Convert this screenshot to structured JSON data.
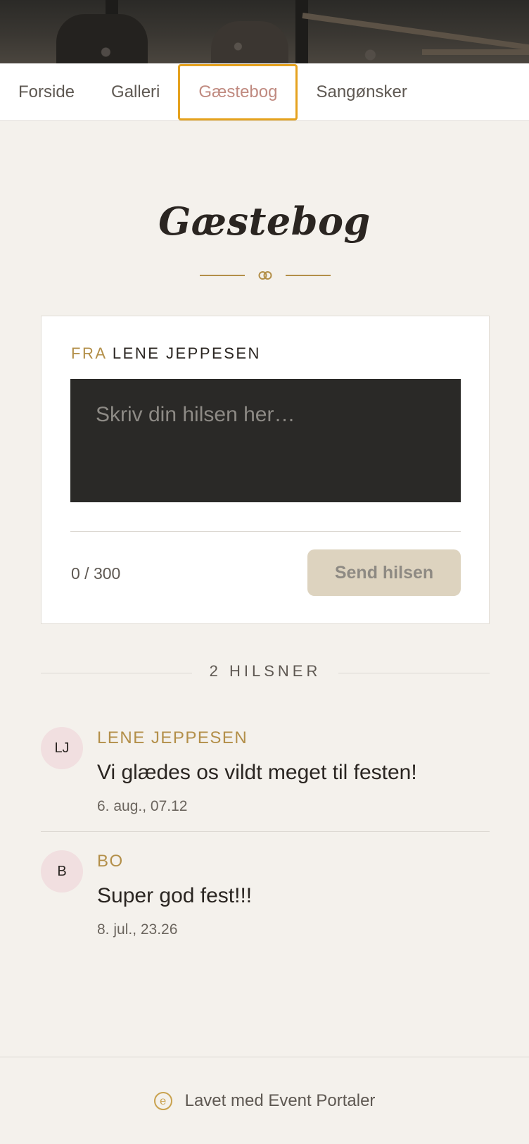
{
  "nav": {
    "items": [
      {
        "label": "Forside"
      },
      {
        "label": "Galleri"
      },
      {
        "label": "Gæstebog"
      },
      {
        "label": "Sangønsker"
      }
    ],
    "active_index": 2
  },
  "page": {
    "title": "Gæstebog"
  },
  "form": {
    "from_label": "FRA",
    "from_name": "LENE JEPPESEN",
    "message_placeholder": "Skriv din hilsen her…",
    "message_value": "",
    "counter": "0 / 300",
    "send_label": "Send hilsen"
  },
  "greetings": {
    "count_label": "2 HILSNER",
    "entries": [
      {
        "initials": "LJ",
        "name": "LENE JEPPESEN",
        "text": "Vi glædes os vildt meget til festen!",
        "date": "6. aug., 07.12"
      },
      {
        "initials": "B",
        "name": "BO",
        "text": "Super god fest!!!",
        "date": "8. jul., 23.26"
      }
    ]
  },
  "footer": {
    "logo_letter": "e",
    "text": "Lavet med Event Portaler"
  },
  "colors": {
    "accent_gold": "#b38f49",
    "active_tab_text": "#c08a80",
    "active_tab_border": "#e5a21f",
    "background": "#f4f1ec",
    "textarea_bg": "#2a2927",
    "avatar_bg": "#f1dfe0",
    "send_button_bg": "#ddd3bf"
  }
}
